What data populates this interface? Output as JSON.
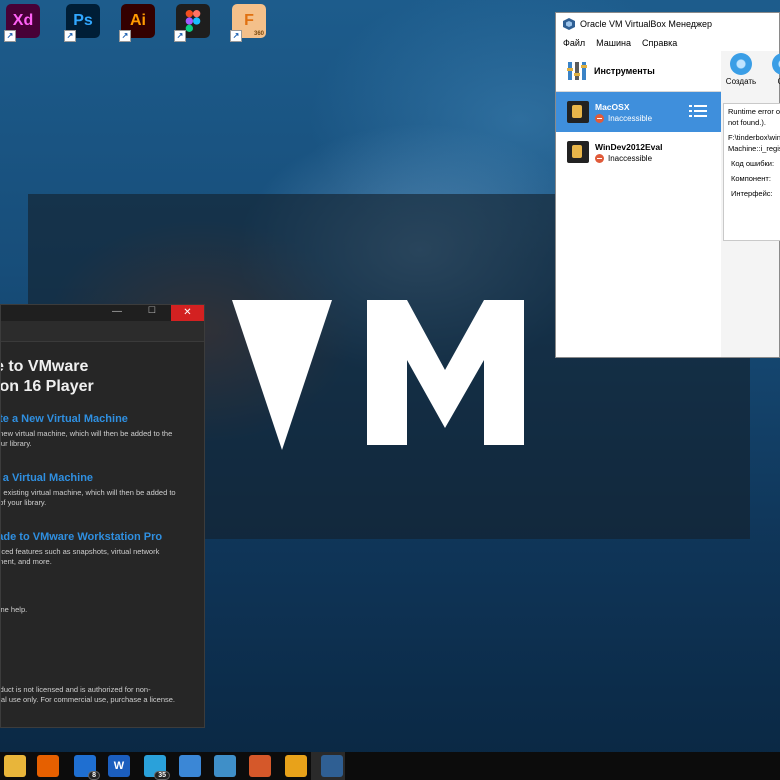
{
  "desktop": {
    "icons": [
      {
        "name": "adobe-xd-icon",
        "label": "Xd",
        "bg": "#470137",
        "fg": "#ff61f6"
      },
      {
        "name": "photoshop-icon",
        "label": "Ps",
        "bg": "#001e36",
        "fg": "#31a8ff"
      },
      {
        "name": "illustrator-icon",
        "label": "Ai",
        "bg": "#330000",
        "fg": "#ff9a00"
      },
      {
        "name": "figma-icon",
        "label": "",
        "bg": "#1e1e1e",
        "fg": "#ffffff"
      },
      {
        "name": "fusion-icon",
        "label": "F",
        "bg": "#f4c08a",
        "fg": "#e07010",
        "tag": "360"
      }
    ],
    "logo_text": "VM"
  },
  "virtualbox": {
    "title": "Oracle VM VirtualBox Менеджер",
    "menu": [
      "Файл",
      "Машина",
      "Справка"
    ],
    "tools_label": "Инструменты",
    "create_label": "Создать",
    "second_button_label": "Об",
    "vms": [
      {
        "name": "MacOSX",
        "state": "Inaccessible",
        "selected": true
      },
      {
        "name": "WinDev2012Eval",
        "state": "Inaccessible",
        "selected": false
      }
    ],
    "error": {
      "line1": "Runtime error op",
      "line2": "not found.).",
      "line3": "F:\\tinderbox\\win",
      "line4": "Machine::i_regis",
      "code_label": "Код ошибки:",
      "component_label": "Компонент:",
      "interface_label": "Интерфейс:"
    }
  },
  "vmware": {
    "min_symbol": "—",
    "max_symbol": "☐",
    "close_symbol": "✕",
    "welcome_line1": "e to VMware",
    "welcome_line2": "ion 16 Player",
    "sections": [
      {
        "title": "ate a New Virtual Machine",
        "desc1": "a new virtual machine, which will then be added to the",
        "desc2": "your library."
      },
      {
        "title": "n a Virtual Machine",
        "desc1": "an existing virtual machine, which will then be added to",
        "desc2": "p of your library."
      },
      {
        "title": "rade to VMware Workstation Pro",
        "desc1": "anced features such as snapshots, virtual network",
        "desc2": "ement, and more."
      },
      {
        "title": "",
        "desc1": "nline help.",
        "desc2": ""
      }
    ],
    "footer1": "roduct is not licensed and is authorized for non-",
    "footer2": "rcial use only. For commercial use, purchase a license.",
    "footer_link": "w."
  },
  "taskbar": {
    "icons": [
      {
        "name": "file-explorer-icon",
        "label": "",
        "bg": "#e8b53a"
      },
      {
        "name": "firefox-icon",
        "label": "",
        "bg": "#e66000"
      },
      {
        "name": "tasks-app-icon",
        "label": "",
        "bg": "#1f6fd1",
        "badge": "8"
      },
      {
        "name": "word-icon",
        "label": "W",
        "bg": "#1b5ebe"
      },
      {
        "name": "telegram-icon",
        "label": "",
        "bg": "#2aa1da",
        "badge": "35"
      },
      {
        "name": "photos-icon",
        "label": "",
        "bg": "#3b87d6"
      },
      {
        "name": "remote-desktop-icon",
        "label": "",
        "bg": "#3f8fc8"
      },
      {
        "name": "matlab-icon",
        "label": "",
        "bg": "#d5582a"
      },
      {
        "name": "vmware-taskbar-icon",
        "label": "",
        "bg": "#e8a21a"
      },
      {
        "name": "virtualbox-taskbar-icon",
        "label": "",
        "bg": "#2f5f93"
      }
    ]
  },
  "colors": {
    "accent_blue": "#2f8fe0",
    "vbox_selected": "#3f8fdc",
    "close_red": "#d32121"
  }
}
